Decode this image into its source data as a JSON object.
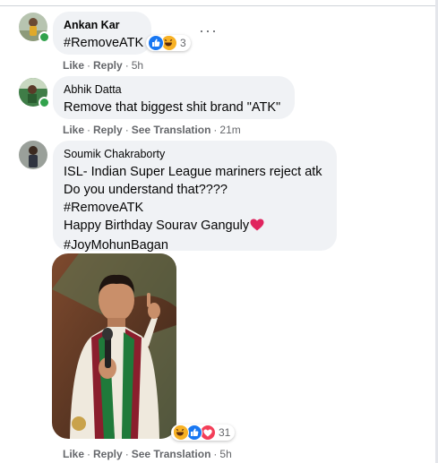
{
  "comments": [
    {
      "author": "Ankan Kar",
      "lines": [
        "#RemoveATK"
      ],
      "reaction_count": "3",
      "more_label": "···",
      "actions": {
        "like": "Like",
        "reply": "Reply",
        "time": "5h"
      }
    },
    {
      "author": "Abhik Datta",
      "lines": [
        "Remove that biggest shit brand \"ATK\""
      ],
      "actions": {
        "like": "Like",
        "reply": "Reply",
        "translation": "See Translation",
        "time": "21m"
      }
    },
    {
      "author": "Soumik Chakraborty",
      "lines": [
        "ISL- Indian Super League mariners reject atk",
        "Do you understand that????",
        "#RemoveATK",
        "Happy Birthday Sourav Ganguly",
        "#JoyMohunBagan"
      ],
      "reaction_count": "31",
      "actions": {
        "like": "Like",
        "reply": "Reply",
        "translation": "See Translation",
        "time": "5h"
      }
    }
  ],
  "separator": "·",
  "icons": {
    "like_reaction": "like-icon",
    "haha_reaction": "haha-icon",
    "love_reaction": "love-icon",
    "heart_emoji": "heart-icon",
    "more": "more-options-icon"
  },
  "colors": {
    "bubble": "#f0f2f5",
    "meta_text": "#65676b",
    "online": "#31a24c",
    "like_blue": "#1877f2",
    "love_red": "#f33e58",
    "haha_yellow": "#f7b125"
  }
}
